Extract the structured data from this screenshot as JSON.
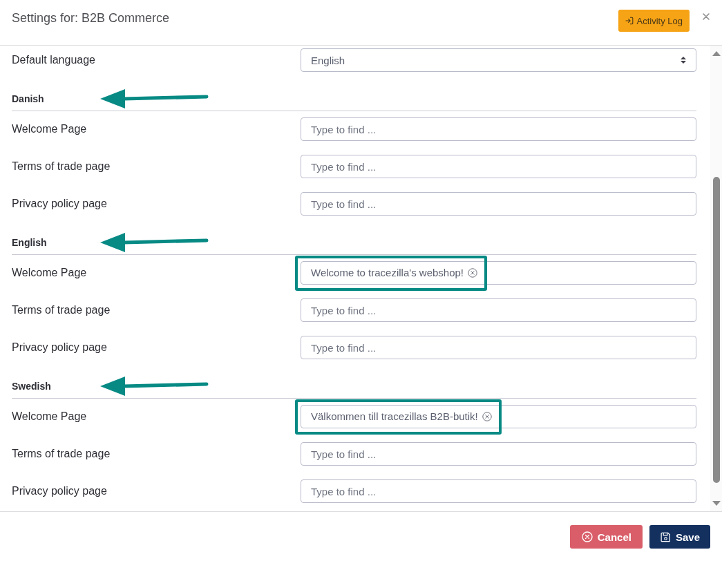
{
  "dialog": {
    "title": "Settings for: B2B Commerce",
    "activity_button": "Activity Log"
  },
  "default_language": {
    "label": "Default language",
    "value": "English"
  },
  "sections": [
    {
      "title": "Danish",
      "arrow": true,
      "rows": [
        {
          "label": "Welcome Page",
          "placeholder": "Type to find ...",
          "highlighted": false
        },
        {
          "label": "Terms of trade page",
          "placeholder": "Type to find ...",
          "highlighted": false
        },
        {
          "label": "Privacy policy page",
          "placeholder": "Type to find ...",
          "highlighted": false
        }
      ]
    },
    {
      "title": "English",
      "arrow": true,
      "rows": [
        {
          "label": "Welcome Page",
          "value": "Welcome to tracezilla's webshop!",
          "highlighted": true
        },
        {
          "label": "Terms of trade page",
          "placeholder": "Type to find ...",
          "highlighted": false
        },
        {
          "label": "Privacy policy page",
          "placeholder": "Type to find ...",
          "highlighted": false
        }
      ]
    },
    {
      "title": "Swedish",
      "arrow": true,
      "rows": [
        {
          "label": "Welcome Page",
          "value": "Välkommen till tracezillas B2B-butik!",
          "highlighted": true
        },
        {
          "label": "Terms of trade page",
          "placeholder": "Type to find ...",
          "highlighted": false
        },
        {
          "label": "Privacy policy page",
          "placeholder": "Type to find ...",
          "highlighted": false
        }
      ]
    }
  ],
  "footer": {
    "buttons": [
      {
        "label": "Cancel",
        "kind": "cancel"
      },
      {
        "label": "Save",
        "kind": "save"
      }
    ]
  }
}
